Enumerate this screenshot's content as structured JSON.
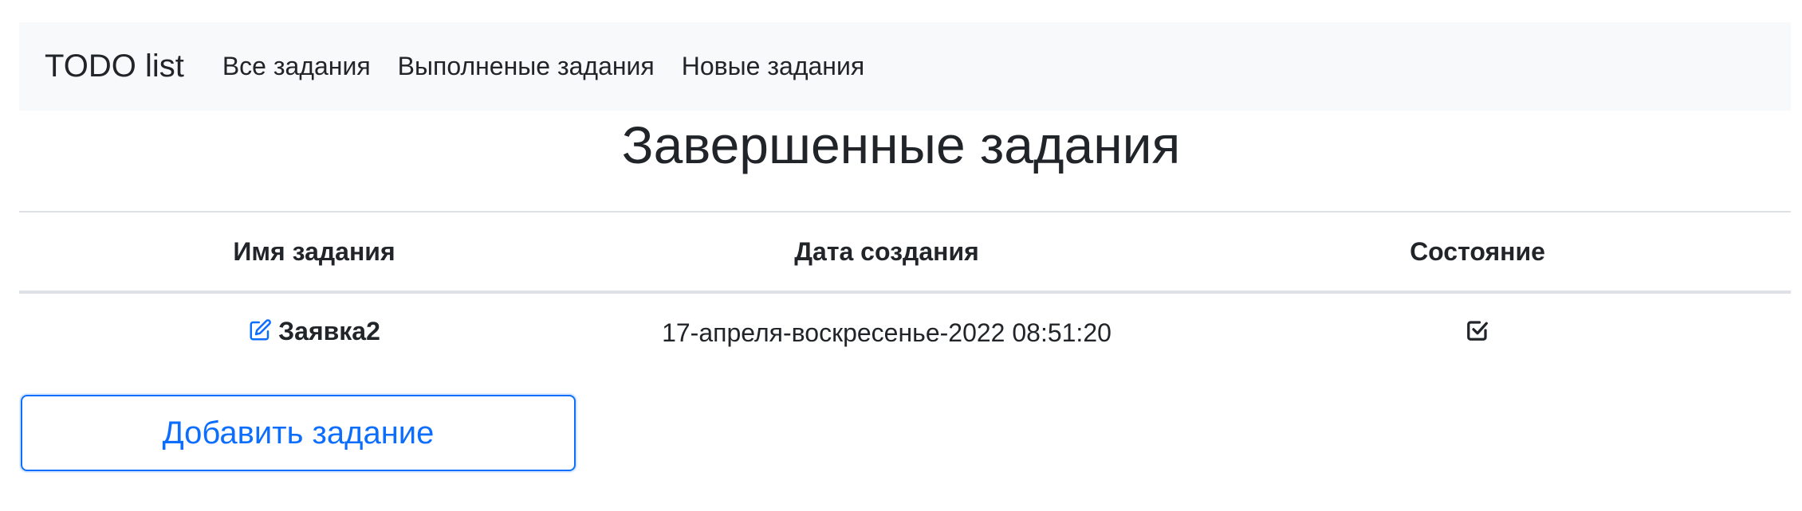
{
  "navbar": {
    "brand": "TODO list",
    "links": [
      {
        "label": "Все задания"
      },
      {
        "label": "Выполненые задания"
      },
      {
        "label": "Новые задания"
      }
    ]
  },
  "page": {
    "title": "Завершенные задания"
  },
  "table": {
    "columns": [
      "Имя задания",
      "Дата создания",
      "Состояние"
    ],
    "rows": [
      {
        "name": "Заявка2",
        "created": "17-апреля-воскресенье-2022 08:51:20",
        "state_icon": "checked-square-icon",
        "name_icon": "edit-icon"
      }
    ]
  },
  "actions": {
    "add_label": "Добавить задание"
  },
  "colors": {
    "primary": "#0d6efd",
    "navbar_bg": "#f8f9fa",
    "text": "#212529",
    "border": "#dee2e6"
  }
}
